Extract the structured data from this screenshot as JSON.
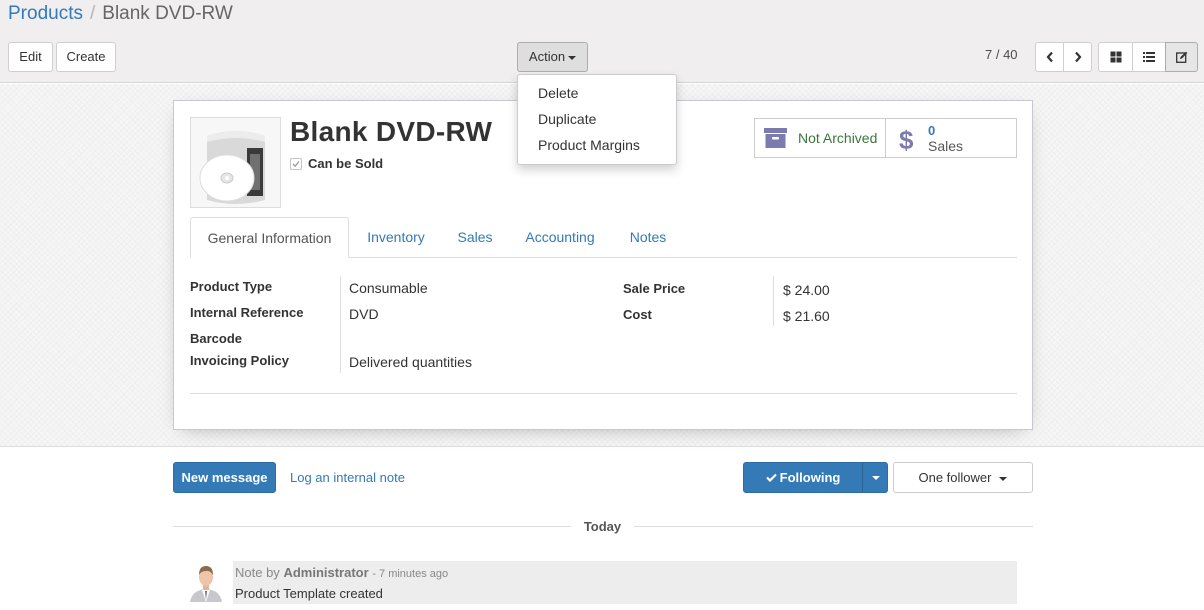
{
  "breadcrumb": {
    "parent": "Products",
    "separator": "/",
    "current": "Blank DVD-RW"
  },
  "toolbar": {
    "edit_label": "Edit",
    "create_label": "Create",
    "action_label": "Action",
    "pager": "7 / 40"
  },
  "action_menu": {
    "items": [
      "Delete",
      "Duplicate",
      "Product Margins"
    ]
  },
  "product": {
    "name": "Blank DVD-RW",
    "can_be_sold_label": "Can be Sold",
    "can_be_sold": true
  },
  "smart_buttons": {
    "archive_label": "Not Archived",
    "sales_value": "0",
    "sales_label": "Sales"
  },
  "tabs": [
    "General Information",
    "Inventory",
    "Sales",
    "Accounting",
    "Notes"
  ],
  "fields": {
    "product_type_label": "Product Type",
    "product_type_value": "Consumable",
    "internal_ref_label": "Internal Reference",
    "internal_ref_value": "DVD",
    "barcode_label": "Barcode",
    "invoicing_policy_label": "Invoicing Policy",
    "invoicing_policy_value": "Delivered quantities",
    "sale_price_label": "Sale Price",
    "sale_price_value": "$ 24.00",
    "cost_label": "Cost",
    "cost_value": "$ 21.60"
  },
  "chatter": {
    "new_message_label": "New message",
    "log_note_label": "Log an internal note",
    "following_label": "Following",
    "followers_label": "One follower",
    "date_separator": "Today",
    "message": {
      "prefix": "Note by",
      "author": "Administrator",
      "time": "- 7 minutes ago",
      "body": "Product Template created"
    }
  },
  "colors": {
    "primary": "#337ab7",
    "archived_green": "#3c763d",
    "smart_icon": "#7c7bad",
    "control_panel_bg": "#f0eeee"
  }
}
